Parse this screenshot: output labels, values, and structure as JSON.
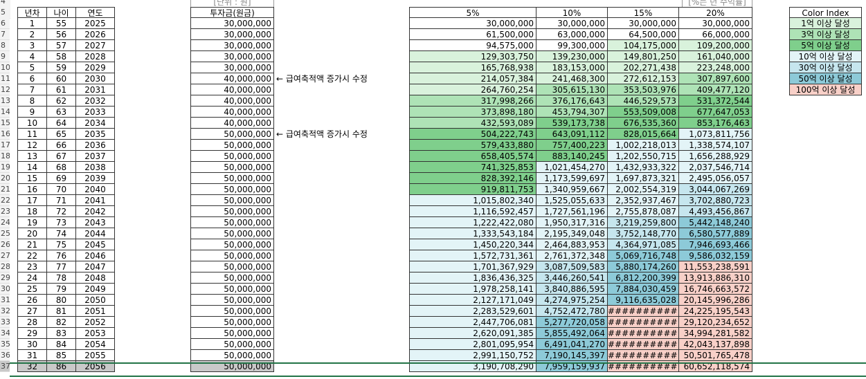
{
  "header_row_labels": {
    "row4": "4",
    "row5": "5"
  },
  "units_note": "[단위 : 원]",
  "return_note": "[%는 년 수익률]",
  "columns": {
    "year_index": "년차",
    "age": "나이",
    "year": "연도",
    "investment": "투자금(원금)"
  },
  "rate_headers": [
    "5%",
    "10%",
    "15%",
    "20%"
  ],
  "notes": {
    "row11": "← 급여축적액 증가시 수정",
    "row16": "← 급여축적액 증가시 수정"
  },
  "color_index": {
    "title": "Color Index",
    "items": [
      {
        "label": "1억 이상 달성",
        "color": "#d9f2dc"
      },
      {
        "label": "3억 이상 달성",
        "color": "#aee3b6"
      },
      {
        "label": "5억 이상 달성",
        "color": "#7fcf8c"
      },
      {
        "label": "10억 이상 달성",
        "color": "#e3f4f7"
      },
      {
        "label": "30억 이상 달성",
        "color": "#c6e6ee"
      },
      {
        "label": "50억 이상 달성",
        "color": "#8dcad8"
      },
      {
        "label": "100억 이상 달성",
        "color": "#f8d0c8"
      }
    ]
  },
  "colors": {
    "white": "#ffffff",
    "selection": "#217346",
    "header_bg": "#f3f3f3",
    "selected_row": "#c9c9c9"
  },
  "rows": [
    {
      "rn": "6",
      "n": "1",
      "age": "55",
      "yr": "2025",
      "inv": "30,000,000",
      "v": [
        "30,000,000",
        "30,000,000",
        "30,000,000",
        "30,000,000"
      ],
      "t": [
        0,
        0,
        0,
        0
      ]
    },
    {
      "rn": "7",
      "n": "2",
      "age": "56",
      "yr": "2026",
      "inv": "30,000,000",
      "v": [
        "61,500,000",
        "63,000,000",
        "64,500,000",
        "66,000,000"
      ],
      "t": [
        0,
        0,
        0,
        0
      ]
    },
    {
      "rn": "8",
      "n": "3",
      "age": "57",
      "yr": "2027",
      "inv": "30,000,000",
      "v": [
        "94,575,000",
        "99,300,000",
        "104,175,000",
        "109,200,000"
      ],
      "t": [
        0,
        0,
        1,
        1
      ]
    },
    {
      "rn": "9",
      "n": "4",
      "age": "58",
      "yr": "2028",
      "inv": "30,000,000",
      "v": [
        "129,303,750",
        "139,230,000",
        "149,801,250",
        "161,040,000"
      ],
      "t": [
        1,
        1,
        1,
        1
      ]
    },
    {
      "rn": "10",
      "n": "5",
      "age": "59",
      "yr": "2029",
      "inv": "30,000,000",
      "v": [
        "165,768,938",
        "183,153,000",
        "202,271,438",
        "223,248,000"
      ],
      "t": [
        1,
        1,
        1,
        1
      ]
    },
    {
      "rn": "11",
      "n": "6",
      "age": "60",
      "yr": "2030",
      "inv": "40,000,000",
      "v": [
        "214,057,384",
        "241,468,300",
        "272,612,153",
        "307,897,600"
      ],
      "t": [
        1,
        1,
        1,
        2
      ]
    },
    {
      "rn": "12",
      "n": "7",
      "age": "61",
      "yr": "2031",
      "inv": "40,000,000",
      "v": [
        "264,760,254",
        "305,615,130",
        "353,503,976",
        "409,477,120"
      ],
      "t": [
        1,
        2,
        2,
        2
      ]
    },
    {
      "rn": "13",
      "n": "8",
      "age": "62",
      "yr": "2032",
      "inv": "40,000,000",
      "v": [
        "317,998,266",
        "376,176,643",
        "446,529,573",
        "531,372,544"
      ],
      "t": [
        2,
        2,
        2,
        3
      ]
    },
    {
      "rn": "14",
      "n": "9",
      "age": "63",
      "yr": "2033",
      "inv": "40,000,000",
      "v": [
        "373,898,180",
        "453,794,307",
        "553,509,008",
        "677,647,053"
      ],
      "t": [
        2,
        2,
        3,
        3
      ]
    },
    {
      "rn": "15",
      "n": "10",
      "age": "64",
      "yr": "2034",
      "inv": "40,000,000",
      "v": [
        "432,593,089",
        "539,173,738",
        "676,535,360",
        "853,176,463"
      ],
      "t": [
        2,
        3,
        3,
        3
      ]
    },
    {
      "rn": "16",
      "n": "11",
      "age": "65",
      "yr": "2035",
      "inv": "50,000,000",
      "v": [
        "504,222,743",
        "643,091,112",
        "828,015,664",
        "1,073,811,756"
      ],
      "t": [
        3,
        3,
        3,
        4
      ]
    },
    {
      "rn": "17",
      "n": "12",
      "age": "66",
      "yr": "2036",
      "inv": "50,000,000",
      "v": [
        "579,433,880",
        "757,400,223",
        "1,002,218,013",
        "1,338,574,107"
      ],
      "t": [
        3,
        3,
        4,
        4
      ]
    },
    {
      "rn": "18",
      "n": "13",
      "age": "67",
      "yr": "2037",
      "inv": "50,000,000",
      "v": [
        "658,405,574",
        "883,140,245",
        "1,202,550,715",
        "1,656,288,929"
      ],
      "t": [
        3,
        3,
        4,
        4
      ]
    },
    {
      "rn": "19",
      "n": "14",
      "age": "68",
      "yr": "2038",
      "inv": "50,000,000",
      "v": [
        "741,325,853",
        "1,021,454,270",
        "1,432,933,322",
        "2,037,546,714"
      ],
      "t": [
        3,
        4,
        4,
        4
      ]
    },
    {
      "rn": "20",
      "n": "15",
      "age": "69",
      "yr": "2039",
      "inv": "50,000,000",
      "v": [
        "828,392,146",
        "1,173,599,697",
        "1,697,873,321",
        "2,495,056,057"
      ],
      "t": [
        3,
        4,
        4,
        4
      ]
    },
    {
      "rn": "21",
      "n": "16",
      "age": "70",
      "yr": "2040",
      "inv": "50,000,000",
      "v": [
        "919,811,753",
        "1,340,959,667",
        "2,002,554,319",
        "3,044,067,269"
      ],
      "t": [
        3,
        4,
        4,
        5
      ]
    },
    {
      "rn": "22",
      "n": "17",
      "age": "71",
      "yr": "2041",
      "inv": "50,000,000",
      "v": [
        "1,015,802,340",
        "1,525,055,633",
        "2,352,937,467",
        "3,702,880,723"
      ],
      "t": [
        4,
        4,
        4,
        5
      ]
    },
    {
      "rn": "23",
      "n": "18",
      "age": "72",
      "yr": "2042",
      "inv": "50,000,000",
      "v": [
        "1,116,592,457",
        "1,727,561,196",
        "2,755,878,087",
        "4,493,456,867"
      ],
      "t": [
        4,
        4,
        4,
        5
      ]
    },
    {
      "rn": "24",
      "n": "19",
      "age": "73",
      "yr": "2043",
      "inv": "50,000,000",
      "v": [
        "1,222,422,080",
        "1,950,317,316",
        "3,219,259,800",
        "5,442,148,240"
      ],
      "t": [
        4,
        4,
        5,
        6
      ]
    },
    {
      "rn": "25",
      "n": "20",
      "age": "74",
      "yr": "2044",
      "inv": "50,000,000",
      "v": [
        "1,333,543,184",
        "2,195,349,048",
        "3,752,148,770",
        "6,580,577,889"
      ],
      "t": [
        4,
        4,
        5,
        6
      ]
    },
    {
      "rn": "26",
      "n": "21",
      "age": "75",
      "yr": "2045",
      "inv": "50,000,000",
      "v": [
        "1,450,220,344",
        "2,464,883,953",
        "4,364,971,085",
        "7,946,693,466"
      ],
      "t": [
        4,
        4,
        5,
        6
      ]
    },
    {
      "rn": "27",
      "n": "22",
      "age": "76",
      "yr": "2046",
      "inv": "50,000,000",
      "v": [
        "1,572,731,361",
        "2,761,372,348",
        "5,069,716,748",
        "9,586,032,159"
      ],
      "t": [
        4,
        4,
        6,
        6
      ]
    },
    {
      "rn": "28",
      "n": "23",
      "age": "77",
      "yr": "2047",
      "inv": "50,000,000",
      "v": [
        "1,701,367,929",
        "3,087,509,583",
        "5,880,174,260",
        "11,553,238,591"
      ],
      "t": [
        4,
        5,
        6,
        7
      ]
    },
    {
      "rn": "29",
      "n": "24",
      "age": "78",
      "yr": "2048",
      "inv": "50,000,000",
      "v": [
        "1,836,436,325",
        "3,446,260,541",
        "6,812,200,399",
        "13,913,886,310"
      ],
      "t": [
        4,
        5,
        6,
        7
      ]
    },
    {
      "rn": "30",
      "n": "25",
      "age": "79",
      "yr": "2049",
      "inv": "50,000,000",
      "v": [
        "1,978,258,141",
        "3,840,886,595",
        "7,884,030,459",
        "16,746,663,572"
      ],
      "t": [
        4,
        5,
        6,
        7
      ]
    },
    {
      "rn": "31",
      "n": "26",
      "age": "80",
      "yr": "2050",
      "inv": "50,000,000",
      "v": [
        "2,127,171,049",
        "4,274,975,254",
        "9,116,635,028",
        "20,145,996,286"
      ],
      "t": [
        4,
        5,
        6,
        7
      ]
    },
    {
      "rn": "32",
      "n": "27",
      "age": "81",
      "yr": "2051",
      "inv": "50,000,000",
      "v": [
        "2,283,529,601",
        "4,752,472,780",
        "##########",
        "24,225,195,543"
      ],
      "t": [
        4,
        5,
        7,
        7
      ]
    },
    {
      "rn": "33",
      "n": "28",
      "age": "82",
      "yr": "2052",
      "inv": "50,000,000",
      "v": [
        "2,447,706,081",
        "5,277,720,058",
        "##########",
        "29,120,234,652"
      ],
      "t": [
        4,
        6,
        7,
        7
      ]
    },
    {
      "rn": "34",
      "n": "29",
      "age": "83",
      "yr": "2053",
      "inv": "50,000,000",
      "v": [
        "2,620,091,385",
        "5,855,492,064",
        "##########",
        "34,994,281,582"
      ],
      "t": [
        4,
        6,
        7,
        7
      ]
    },
    {
      "rn": "35",
      "n": "30",
      "age": "84",
      "yr": "2054",
      "inv": "50,000,000",
      "v": [
        "2,801,095,954",
        "6,491,041,270",
        "##########",
        "42,043,137,898"
      ],
      "t": [
        4,
        6,
        7,
        7
      ]
    },
    {
      "rn": "36",
      "n": "31",
      "age": "85",
      "yr": "2055",
      "inv": "50,000,000",
      "v": [
        "2,991,150,752",
        "7,190,145,397",
        "##########",
        "50,501,765,478"
      ],
      "t": [
        4,
        6,
        7,
        7
      ]
    },
    {
      "rn": "37",
      "n": "32",
      "age": "86",
      "yr": "2056",
      "inv": "50,000,000",
      "v": [
        "3,190,708,290",
        "7,959,159,937",
        "##########",
        "60,652,118,574"
      ],
      "t": [
        4,
        6,
        7,
        7
      ]
    }
  ]
}
